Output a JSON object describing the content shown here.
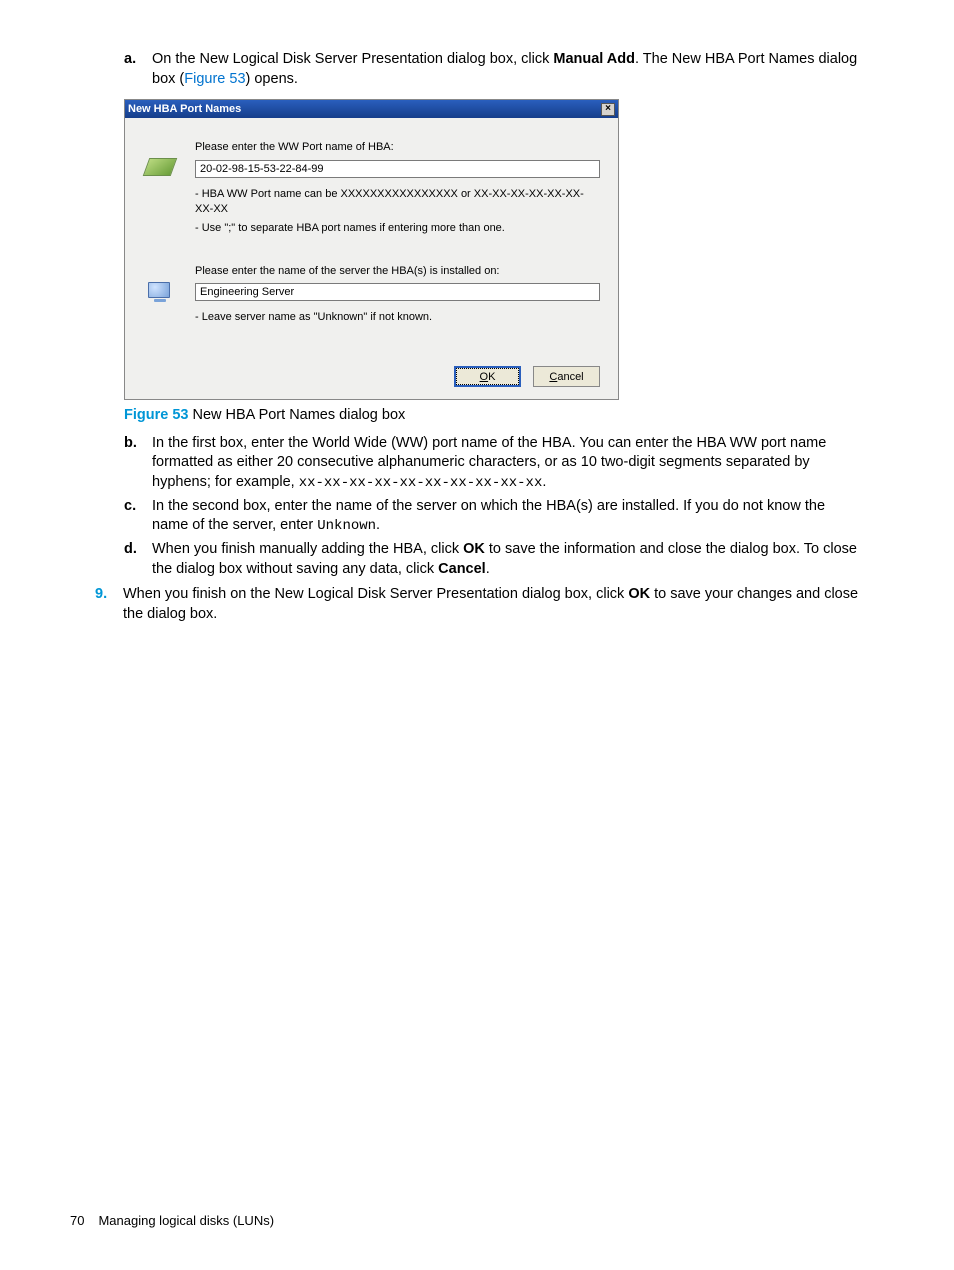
{
  "step_a": {
    "marker": "a.",
    "text_parts": {
      "p1": "On the New Logical Disk Server Presentation dialog box, click ",
      "bold1": "Manual Add",
      "p2": ". The New HBA Port Names dialog box (",
      "link": "Figure 53",
      "p3": ") opens."
    }
  },
  "dialog": {
    "title": "New HBA Port Names",
    "close": "×",
    "section1": {
      "label": "Please enter the WW Port name of HBA:",
      "value": "20-02-98-15-53-22-84-99",
      "hint1": "- HBA WW Port name can be XXXXXXXXXXXXXXXX or XX-XX-XX-XX-XX-XX-XX-XX",
      "hint2": "- Use \";\" to separate HBA port names if entering more than one."
    },
    "section2": {
      "label": "Please enter the name of the server the HBA(s) is installed on:",
      "value": "Engineering Server",
      "hint": "- Leave server name as \"Unknown\" if not known."
    },
    "ok_pre": "",
    "ok_mnemonic": "O",
    "ok_post": "K",
    "cancel_pre": "",
    "cancel_mnemonic": "C",
    "cancel_post": "ancel"
  },
  "figure": {
    "label": "Figure 53",
    "caption": " New HBA Port Names dialog box"
  },
  "step_b": {
    "marker": "b.",
    "p1": "In the first box, enter the World Wide (WW) port name of the HBA. You can enter the HBA WW port name formatted as either 20 consecutive alphanumeric characters, or as 10 two-digit segments separated by hyphens; for example, ",
    "mono": "xx-xx-xx-xx-xx-xx-xx-xx-xx-xx",
    "p2": "."
  },
  "step_c": {
    "marker": "c.",
    "p1": "In the second box, enter the name of the server on which the HBA(s) are installed. If you do not know the name of the server, enter ",
    "mono": "Unknown",
    "p2": "."
  },
  "step_d": {
    "marker": "d.",
    "p1": "When you finish manually adding the HBA, click ",
    "bold1": "OK",
    "p2": " to save the information and close the dialog box. To close the dialog box without saving any data, click ",
    "bold2": "Cancel",
    "p3": "."
  },
  "step_9": {
    "marker": "9.",
    "p1": "When you finish on the New Logical Disk Server Presentation dialog box, click ",
    "bold1": "OK",
    "p2": " to save your changes and close the dialog box."
  },
  "footer": {
    "page": "70",
    "chapter": "Managing logical disks (LUNs)"
  }
}
